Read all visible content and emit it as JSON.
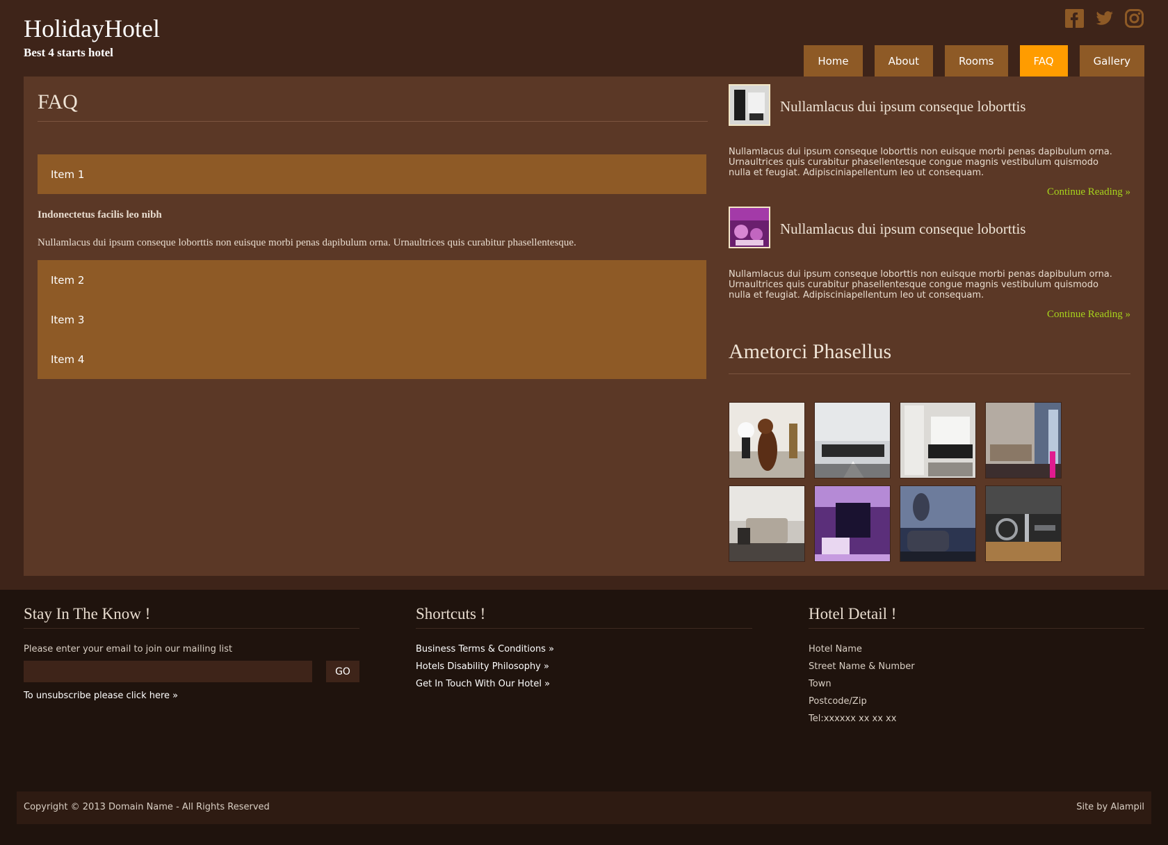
{
  "header": {
    "title": "HolidayHotel",
    "subtitle": "Best 4 starts hotel",
    "social": [
      "facebook-icon",
      "twitter-icon",
      "instagram-icon"
    ],
    "nav": [
      {
        "label": "Home",
        "active": false
      },
      {
        "label": "About",
        "active": false
      },
      {
        "label": "Rooms",
        "active": false
      },
      {
        "label": "FAQ",
        "active": true
      },
      {
        "label": "Gallery",
        "active": false
      }
    ]
  },
  "colors": {
    "background": "#3e2419",
    "panel": "#5b3826",
    "accordion": "#8e5a26",
    "nav_active": "#ff9c00",
    "link_green": "#a7d41c",
    "footer": "#1f130d"
  },
  "faq": {
    "title": "FAQ",
    "items": [
      "Item 1",
      "Item 2",
      "Item 3",
      "Item 4"
    ],
    "open_heading": "Indonectetus facilis leo nibh",
    "open_text": "Nullamlacus dui ipsum conseque loborttis non euisque morbi penas dapibulum orna. Urnaultrices quis curabitur phasellentesque."
  },
  "posts": [
    {
      "title": "Nullamlacus dui ipsum conseque loborttis",
      "text": "Nullamlacus dui ipsum conseque loborttis non euisque morbi penas dapibulum orna. Urnaultrices quis curabitur phasellentesque congue magnis vestibulum quismodo nulla et feugiat. Adipisciniapellentum leo ut consequam.",
      "more": "Continue Reading »"
    },
    {
      "title": "Nullamlacus dui ipsum conseque loborttis",
      "text": "Nullamlacus dui ipsum conseque loborttis non euisque morbi penas dapibulum orna. Urnaultrices quis curabitur phasellentesque congue magnis vestibulum quismodo nulla et feugiat. Adipisciniapellentum leo ut consequam.",
      "more": "Continue Reading »"
    }
  ],
  "gallery": {
    "title": "Ametorci Phasellus"
  },
  "footer": {
    "newsletter": {
      "title": "Stay In The Know !",
      "text": "Please enter your email to join our mailing list",
      "input_value": "",
      "go": "GO",
      "unsubscribe": "To unsubscribe please click here »"
    },
    "shortcuts": {
      "title": "Shortcuts !",
      "links": [
        "Business Terms & Conditions »",
        "Hotels Disability Philosophy »",
        "Get In Touch With Our Hotel »"
      ]
    },
    "hotel": {
      "title": "Hotel Detail !",
      "lines": [
        "Hotel Name",
        "Street Name & Number",
        "Town",
        "Postcode/Zip",
        "Tel:xxxxxx xx xx xx"
      ]
    },
    "copyright": "Copyright © 2013 Domain Name - All Rights Reserved",
    "site_by": "Site by Alampil"
  }
}
